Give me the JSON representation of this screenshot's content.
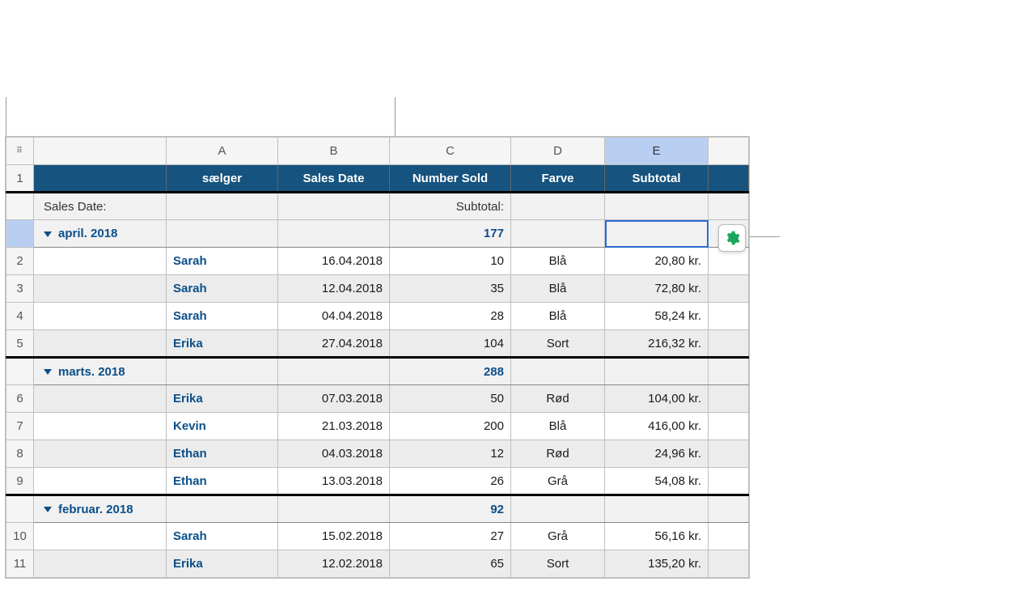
{
  "columns": {
    "A": "A",
    "B": "B",
    "C": "C",
    "D": "D",
    "E": "E"
  },
  "headers": {
    "seller": "sælger",
    "sales_date": "Sales Date",
    "number_sold": "Number Sold",
    "color": "Farve",
    "subtotal": "Subtotal"
  },
  "summary_labels": {
    "sales_date": "Sales Date:",
    "subtotal": "Subtotal:"
  },
  "row_numbers": [
    "1",
    "2",
    "3",
    "4",
    "5",
    "6",
    "7",
    "8",
    "9",
    "10",
    "11"
  ],
  "groups": [
    {
      "label": "april. 2018",
      "number_sold_total": "177",
      "rows": [
        {
          "n": "2",
          "seller": "Sarah",
          "date": "16.04.2018",
          "qty": "10",
          "color": "Blå",
          "money": "20,80 kr."
        },
        {
          "n": "3",
          "seller": "Sarah",
          "date": "12.04.2018",
          "qty": "35",
          "color": "Blå",
          "money": "72,80 kr."
        },
        {
          "n": "4",
          "seller": "Sarah",
          "date": "04.04.2018",
          "qty": "28",
          "color": "Blå",
          "money": "58,24 kr."
        },
        {
          "n": "5",
          "seller": "Erika",
          "date": "27.04.2018",
          "qty": "104",
          "color": "Sort",
          "money": "216,32 kr."
        }
      ]
    },
    {
      "label": "marts. 2018",
      "number_sold_total": "288",
      "rows": [
        {
          "n": "6",
          "seller": "Erika",
          "date": "07.03.2018",
          "qty": "50",
          "color": "Rød",
          "money": "104,00 kr."
        },
        {
          "n": "7",
          "seller": "Kevin",
          "date": "21.03.2018",
          "qty": "200",
          "color": "Blå",
          "money": "416,00 kr."
        },
        {
          "n": "8",
          "seller": "Ethan",
          "date": "04.03.2018",
          "qty": "12",
          "color": "Rød",
          "money": "24,96 kr."
        },
        {
          "n": "9",
          "seller": "Ethan",
          "date": "13.03.2018",
          "qty": "26",
          "color": "Grå",
          "money": "54,08 kr."
        }
      ]
    },
    {
      "label": "februar. 2018",
      "number_sold_total": "92",
      "rows": [
        {
          "n": "10",
          "seller": "Sarah",
          "date": "15.02.2018",
          "qty": "27",
          "color": "Grå",
          "money": "56,16 kr."
        },
        {
          "n": "11",
          "seller": "Erika",
          "date": "12.02.2018",
          "qty": "65",
          "color": "Sort",
          "money": "135,20 kr."
        }
      ]
    }
  ]
}
